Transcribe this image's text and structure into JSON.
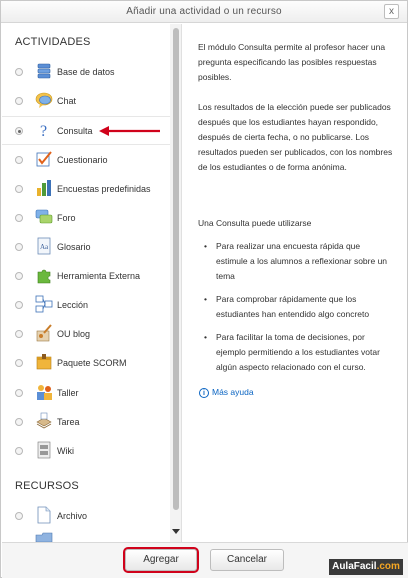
{
  "dialog": {
    "title": "Añadir una actividad o un recurso",
    "close_glyph": "x"
  },
  "activities": {
    "heading": "ACTIVIDADES",
    "items": [
      {
        "label": "Base de datos",
        "icon": "database-icon",
        "selected": false
      },
      {
        "label": "Chat",
        "icon": "chat-icon",
        "selected": false
      },
      {
        "label": "Consulta",
        "icon": "question-icon",
        "selected": true
      },
      {
        "label": "Cuestionario",
        "icon": "quiz-icon",
        "selected": false
      },
      {
        "label": "Encuestas predefinidas",
        "icon": "survey-chart-icon",
        "selected": false
      },
      {
        "label": "Foro",
        "icon": "forum-icon",
        "selected": false
      },
      {
        "label": "Glosario",
        "icon": "glossary-icon",
        "selected": false
      },
      {
        "label": "Herramienta Externa",
        "icon": "puzzle-icon",
        "selected": false
      },
      {
        "label": "Lección",
        "icon": "lesson-icon",
        "selected": false
      },
      {
        "label": "OU blog",
        "icon": "blog-icon",
        "selected": false
      },
      {
        "label": "Paquete SCORM",
        "icon": "scorm-icon",
        "selected": false
      },
      {
        "label": "Taller",
        "icon": "workshop-icon",
        "selected": false
      },
      {
        "label": "Tarea",
        "icon": "assignment-icon",
        "selected": false
      },
      {
        "label": "Wiki",
        "icon": "wiki-icon",
        "selected": false
      }
    ]
  },
  "resources": {
    "heading": "RECURSOS",
    "items": [
      {
        "label": "Archivo",
        "icon": "file-icon",
        "selected": false
      }
    ]
  },
  "description": {
    "p1": "El módulo Consulta permite al profesor hacer una pregunta especificando las posibles respuestas posibles.",
    "p2": "Los resultados de la elección puede ser publicados después que los estudiantes hayan respondido, después de cierta fecha, o no publicarse. Los resultados pueden ser publicados, con los nombres de los estudiantes o de forma anónima.",
    "p3": "Una Consulta puede utilizarse",
    "bullets": [
      "Para realizar una encuesta rápida que estimule a los alumnos a reflexionar sobre un tema",
      "Para comprobar rápidamente que los estudiantes han entendido algo concreto",
      "Para facilitar la toma de decisiones, por ejemplo permitiendo a los estudiantes votar algún aspecto relacionado con el curso."
    ],
    "help_link": "Más ayuda"
  },
  "footer": {
    "add_label": "Agregar",
    "cancel_label": "Cancelar"
  },
  "watermark": {
    "text_main": "AulaFacil",
    "text_suffix": ".com"
  },
  "colors": {
    "highlight_red": "#d0021b",
    "link_blue": "#0a64c2"
  }
}
